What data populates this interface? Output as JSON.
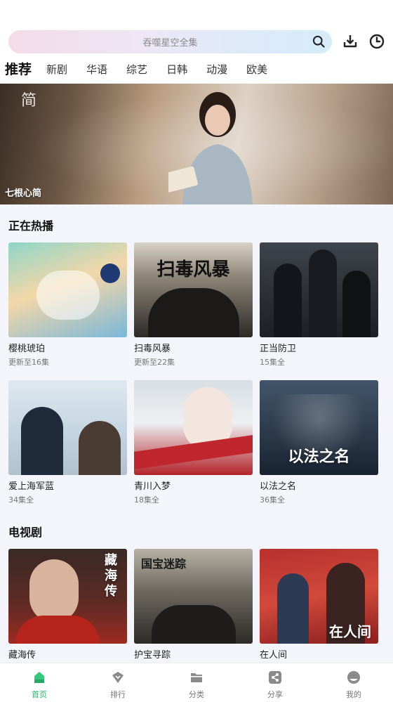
{
  "search": {
    "placeholder": "吞噬星空全集"
  },
  "header_icons": {
    "download": "download-icon",
    "history": "history-clock-icon"
  },
  "tabs": [
    {
      "label": "推荐",
      "active": true
    },
    {
      "label": "新剧"
    },
    {
      "label": "华语"
    },
    {
      "label": "综艺"
    },
    {
      "label": "日韩"
    },
    {
      "label": "动漫"
    },
    {
      "label": "欧美"
    }
  ],
  "banner": {
    "caption": "七根心简"
  },
  "sections": [
    {
      "title": "正在热播",
      "items": [
        {
          "name": "樱桃琥珀",
          "sub": "更新至16集"
        },
        {
          "name": "扫毒风暴",
          "sub": "更新至22集"
        },
        {
          "name": "正当防卫",
          "sub": "15集全"
        },
        {
          "name": "爱上海军蓝",
          "sub": "34集全"
        },
        {
          "name": "青川入梦",
          "sub": "18集全"
        },
        {
          "name": "以法之名",
          "sub": "36集全"
        }
      ]
    },
    {
      "title": "电视剧",
      "items": [
        {
          "name": "藏海传"
        },
        {
          "name": "护宝寻踪"
        },
        {
          "name": "在人间"
        }
      ]
    }
  ],
  "poster_text": {
    "saodu": "扫毒风暴",
    "yifa": "以法之名",
    "canghai": "藏海传",
    "hubao": "国宝迷踪",
    "renjian": "在人间"
  },
  "bottom_nav": [
    {
      "label": "首页",
      "icon": "home-icon",
      "active": true
    },
    {
      "label": "排行",
      "icon": "ranking-icon"
    },
    {
      "label": "分类",
      "icon": "category-folder-icon"
    },
    {
      "label": "分享",
      "icon": "share-icon"
    },
    {
      "label": "我的",
      "icon": "profile-icon"
    }
  ],
  "colors": {
    "accent": "#27b86a",
    "tab_dot": "#e53935"
  }
}
